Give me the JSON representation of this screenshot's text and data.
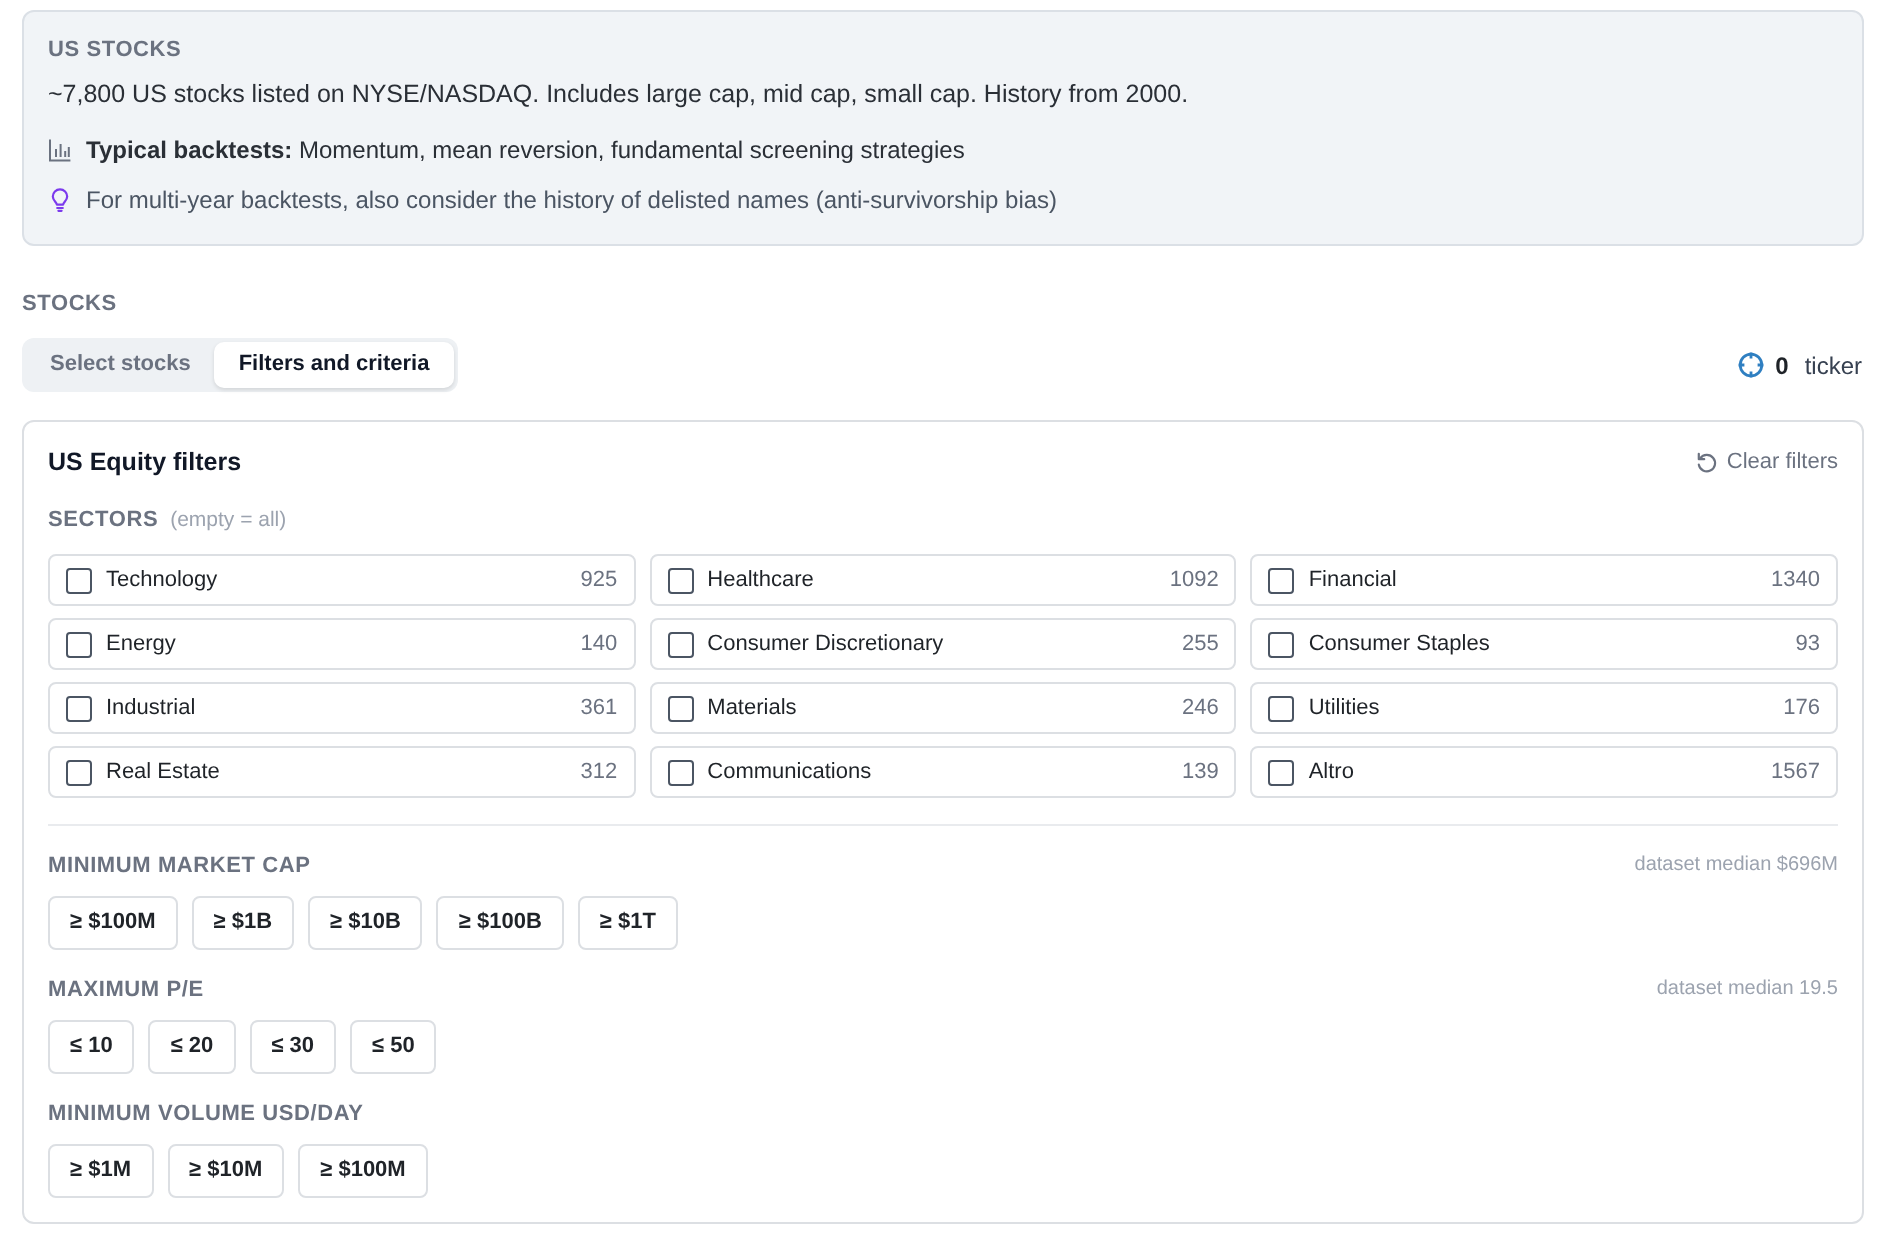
{
  "info_card": {
    "title": "US STOCKS",
    "description": "~7,800 US stocks listed on NYSE/NASDAQ. Includes large cap, mid cap, small cap. History from 2000.",
    "notes": [
      {
        "kind": "backtests",
        "text": "**Typical backtests:** Momentum, mean reversion, fundamental screening strategies"
      },
      {
        "kind": "tip",
        "text": "For multi-year backtests, also consider the history of delisted names (anti-survivorship bias)"
      }
    ]
  },
  "stocks": {
    "label": "STOCKS",
    "tabs": [
      {
        "label": "Select stocks",
        "selected": false
      },
      {
        "label": "Filters and criteria",
        "selected": true
      }
    ],
    "ticker_count": "0",
    "ticker_label": "ticker"
  },
  "filters": {
    "title": "US Equity filters",
    "clear_button": "Clear filters",
    "sectors": {
      "label": "SECTORS",
      "hint": "(empty = all)",
      "items": [
        {
          "name": "Technology",
          "count": "925",
          "checked": false
        },
        {
          "name": "Healthcare",
          "count": "1092",
          "checked": false
        },
        {
          "name": "Financial",
          "count": "1340",
          "checked": false
        },
        {
          "name": "Energy",
          "count": "140",
          "checked": false
        },
        {
          "name": "Consumer Discretionary",
          "count": "255",
          "checked": false
        },
        {
          "name": "Consumer Staples",
          "count": "93",
          "checked": false
        },
        {
          "name": "Industrial",
          "count": "361",
          "checked": false
        },
        {
          "name": "Materials",
          "count": "246",
          "checked": false
        },
        {
          "name": "Utilities",
          "count": "176",
          "checked": false
        },
        {
          "name": "Real Estate",
          "count": "312",
          "checked": false
        },
        {
          "name": "Communications",
          "count": "139",
          "checked": false
        },
        {
          "name": "Altro",
          "count": "1567",
          "checked": false
        }
      ]
    },
    "groups": [
      {
        "label": "MINIMUM MARKET CAP",
        "note": "dataset median $696M",
        "options": [
          {
            "label": "≥ $100M",
            "selected": false
          },
          {
            "label": "≥ $1B",
            "selected": false
          },
          {
            "label": "≥ $10B",
            "selected": false
          },
          {
            "label": "≥ $100B",
            "selected": false
          },
          {
            "label": "≥ $1T",
            "selected": false
          }
        ]
      },
      {
        "label": "MAXIMUM P/E",
        "note": "dataset median 19.5",
        "options": [
          {
            "label": "≤ 10",
            "selected": false
          },
          {
            "label": "≤ 20",
            "selected": false
          },
          {
            "label": "≤ 30",
            "selected": false
          },
          {
            "label": "≤ 50",
            "selected": false
          }
        ]
      },
      {
        "label": "MINIMUM VOLUME USD/DAY",
        "options": [
          {
            "label": "≥ $1M",
            "selected": false
          },
          {
            "label": "≥ $10M",
            "selected": false
          },
          {
            "label": "≥ $100M",
            "selected": false
          }
        ]
      }
    ]
  }
}
